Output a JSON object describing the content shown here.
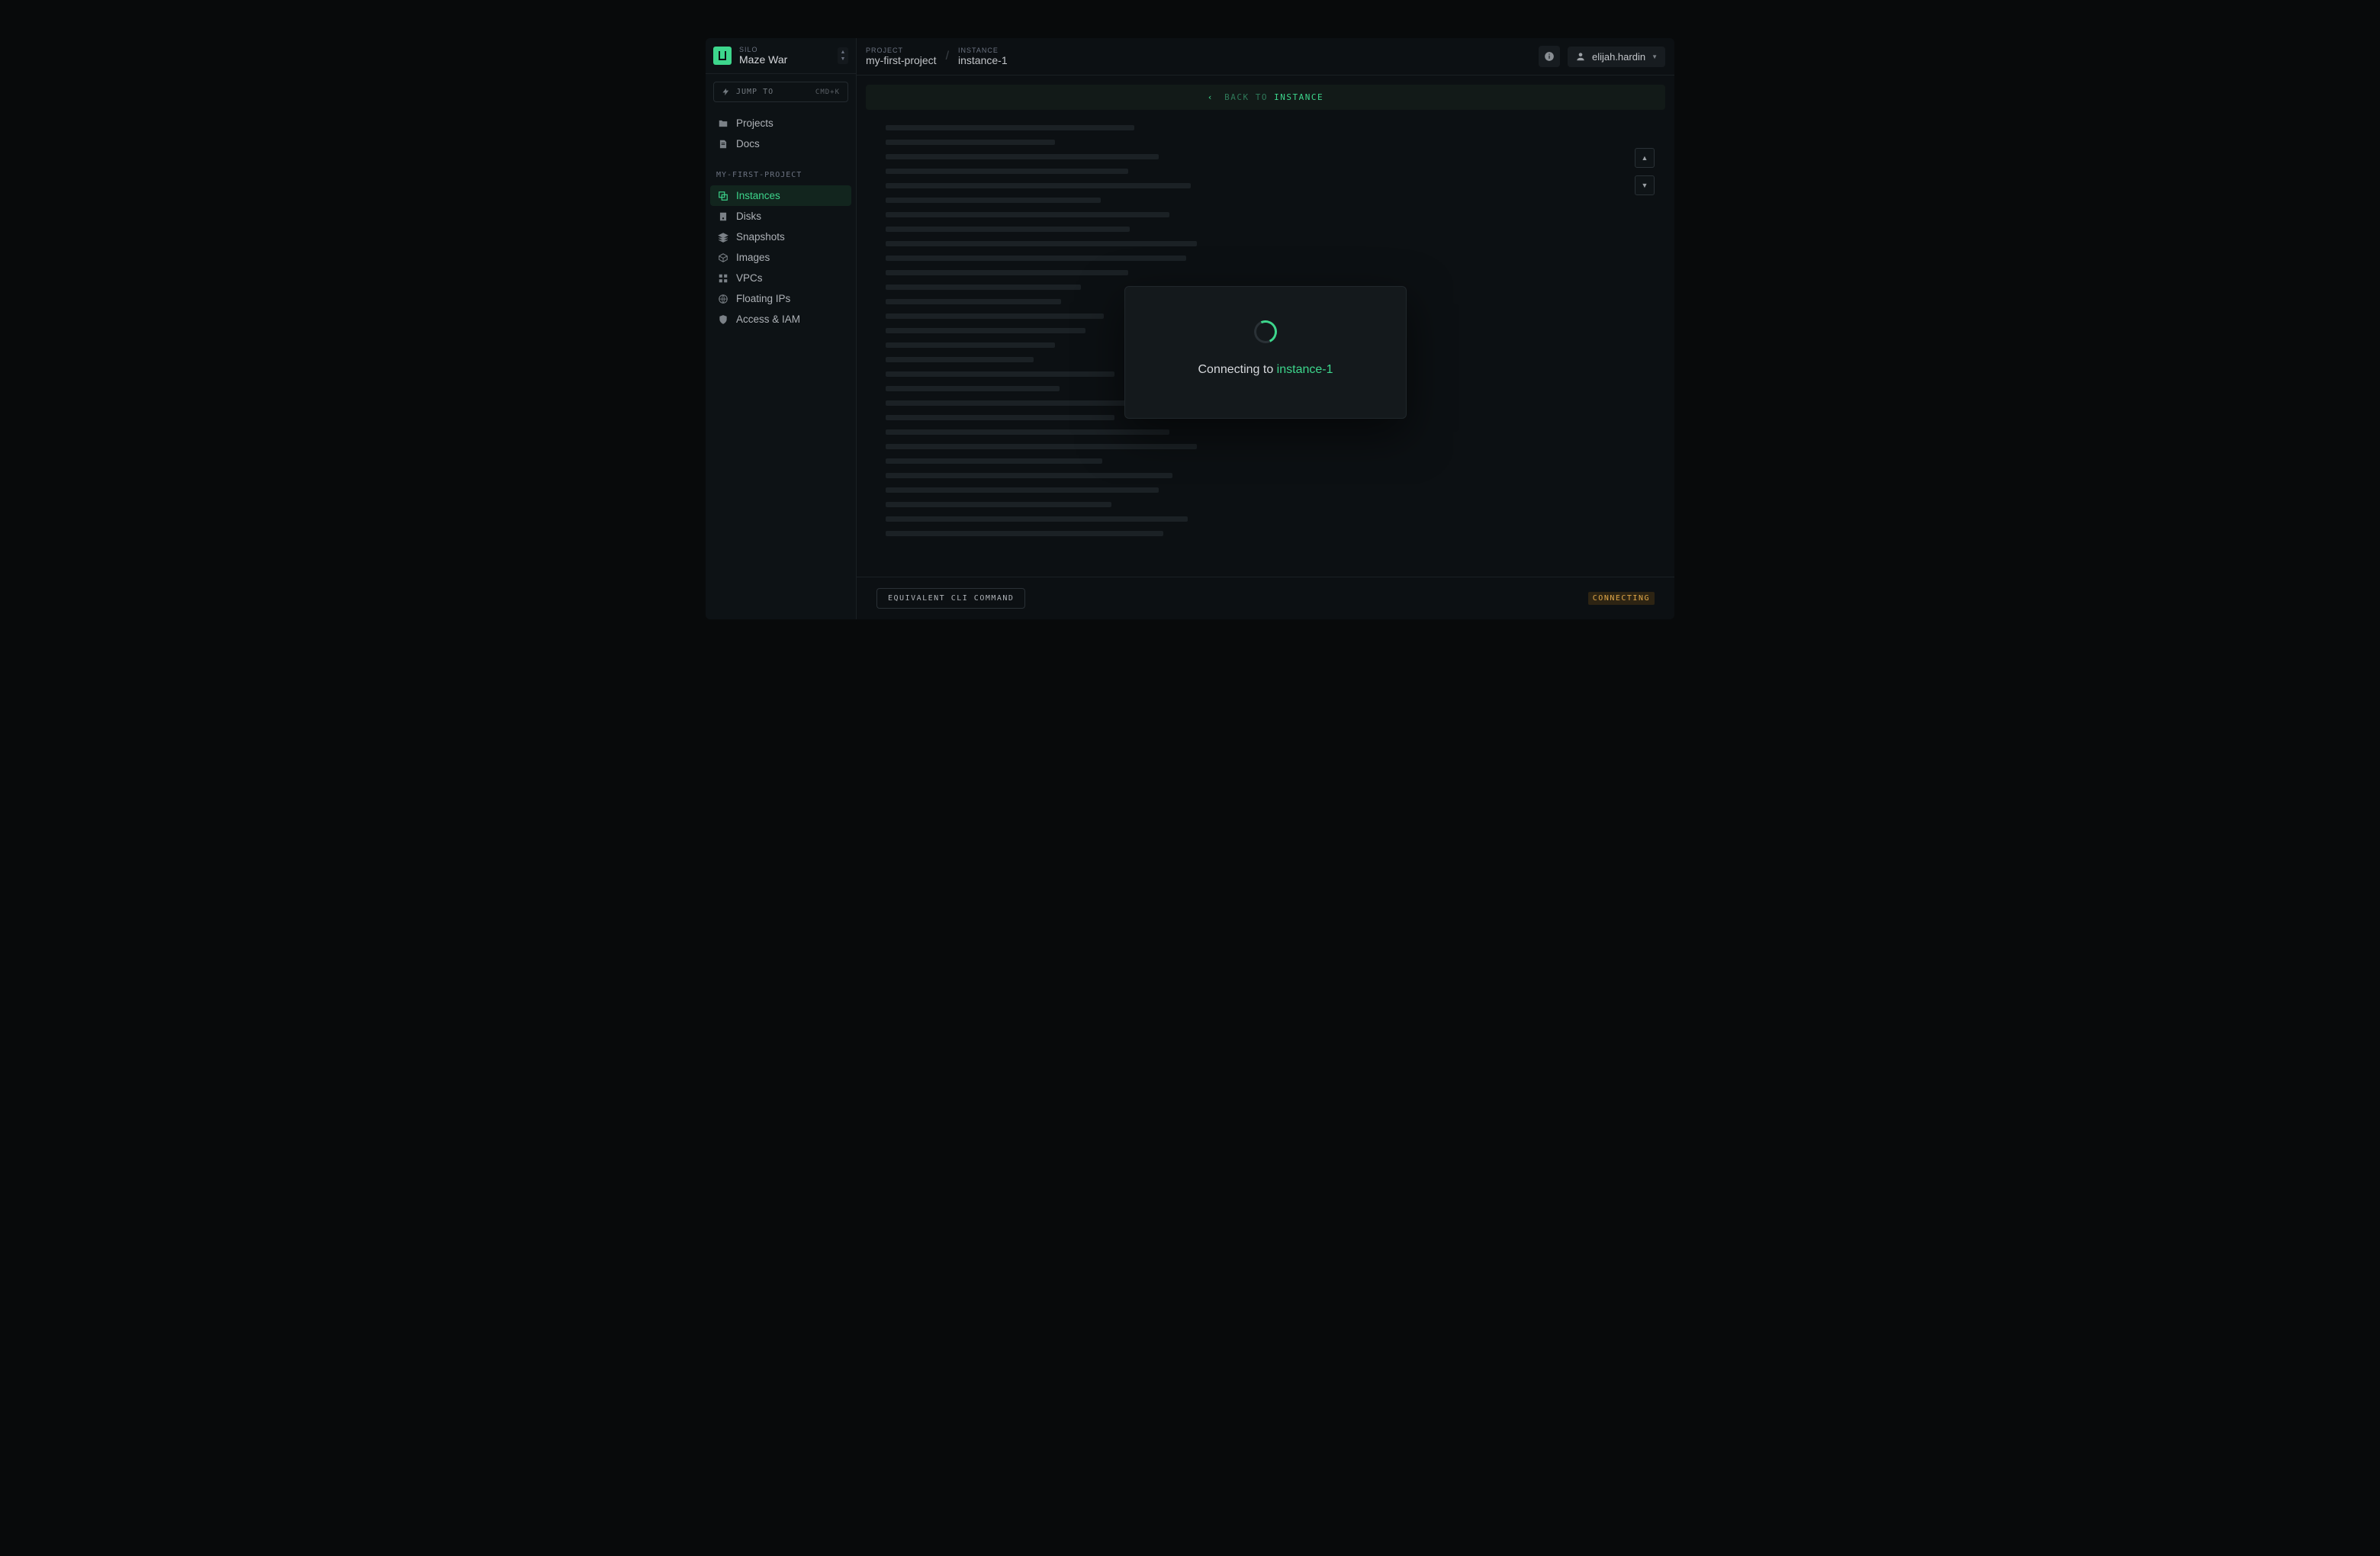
{
  "silo": {
    "label": "SILO",
    "name": "Maze War"
  },
  "jumpto": {
    "label": "JUMP TO",
    "shortcut": "CMD+K"
  },
  "topnav": [
    {
      "label": "Projects"
    },
    {
      "label": "Docs"
    }
  ],
  "project_heading": "MY-FIRST-PROJECT",
  "sidenav": [
    {
      "label": "Instances"
    },
    {
      "label": "Disks"
    },
    {
      "label": "Snapshots"
    },
    {
      "label": "Images"
    },
    {
      "label": "VPCs"
    },
    {
      "label": "Floating IPs"
    },
    {
      "label": "Access & IAM"
    }
  ],
  "breadcrumb": {
    "project_label": "PROJECT",
    "project_value": "my-first-project",
    "instance_label": "INSTANCE",
    "instance_value": "instance-1"
  },
  "user": {
    "name": "elijah.hardin"
  },
  "backbar": {
    "prefix": "BACK TO ",
    "target": "INSTANCE"
  },
  "modal": {
    "prefix": "Connecting to ",
    "instance": "instance-1"
  },
  "footer": {
    "cli": "EQUIVALENT CLI COMMAND",
    "status": "CONNECTING"
  },
  "skeleton_widths": [
    326,
    222,
    358,
    318,
    400,
    282,
    372,
    320,
    408,
    394,
    318,
    256,
    230,
    286,
    262,
    222,
    194,
    300,
    228,
    364,
    300,
    372,
    408,
    284,
    376,
    358,
    296,
    396,
    364
  ]
}
